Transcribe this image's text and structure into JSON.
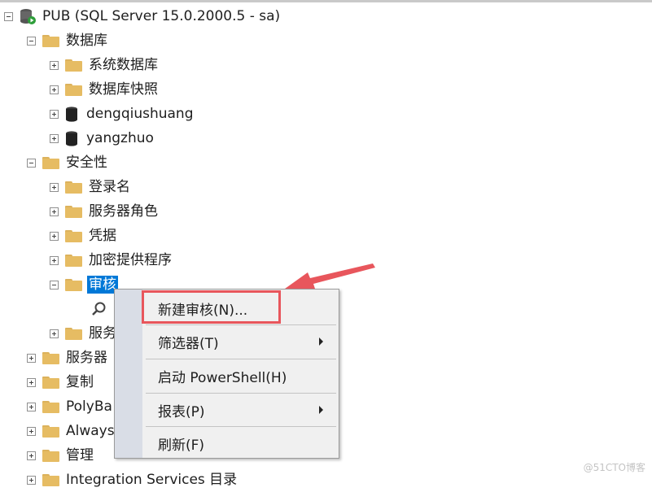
{
  "tree": {
    "server": "PUB (SQL Server 15.0.2000.5 - sa)",
    "databases": "数据库",
    "system_databases": "系统数据库",
    "db_snapshots": "数据库快照",
    "db1": "dengqiushuang",
    "db2": "yangzhuo",
    "security": "安全性",
    "logins": "登录名",
    "server_roles": "服务器角色",
    "credentials": "凭据",
    "crypto_providers": "加密提供程序",
    "audits": "审核",
    "server_audit_specs_partial": "服务",
    "server_objects_partial": "服务器",
    "replication": "复制",
    "polybase_partial": "PolyBa",
    "always_on_partial": "Always",
    "management": "管理",
    "integration_services": "Integration Services 目录"
  },
  "context_menu": {
    "items": [
      {
        "label": "新建审核(N)...",
        "submenu": false
      },
      {
        "label": "筛选器(T)",
        "submenu": true
      },
      {
        "label": "启动 PowerShell(H)",
        "submenu": false
      },
      {
        "label": "报表(P)",
        "submenu": true
      },
      {
        "label": "刷新(F)",
        "submenu": false
      }
    ]
  },
  "watermark": "@51CTO博客",
  "colors": {
    "selection": "#0078d7",
    "annotation": "#e8565c",
    "folder": "#e6bc63"
  }
}
